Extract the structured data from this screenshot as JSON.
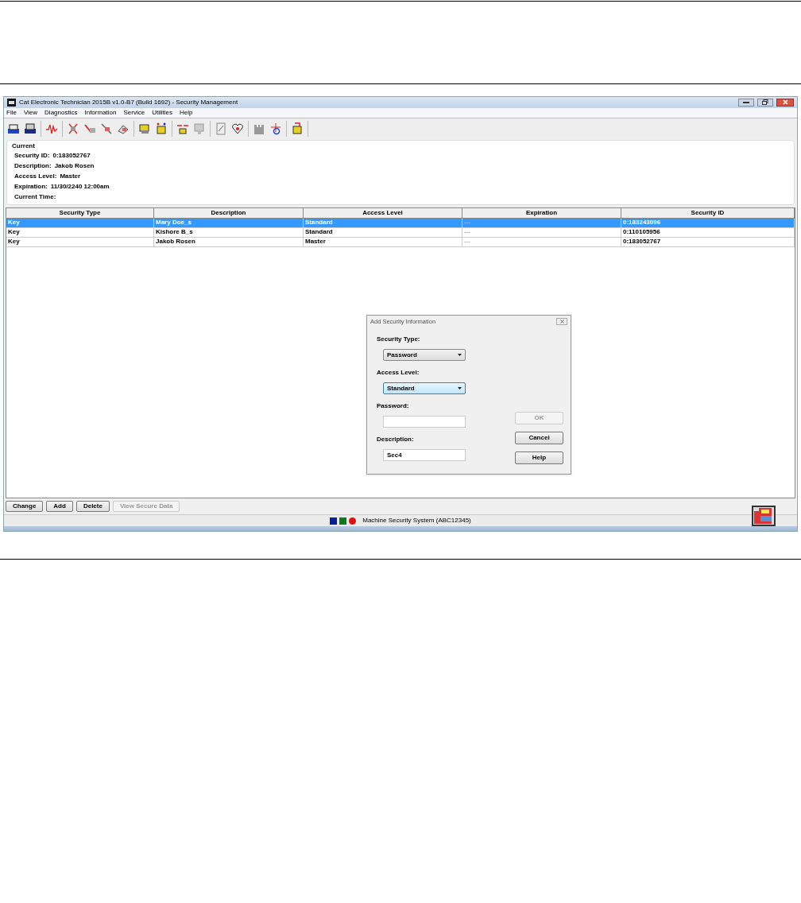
{
  "window": {
    "title": "Cat Electronic Technician 2015B v1.0-B7 (Build 1692) - Security Management"
  },
  "menu": [
    "File",
    "View",
    "Diagnostics",
    "Information",
    "Service",
    "Utilities",
    "Help"
  ],
  "current": {
    "title": "Current",
    "fields": [
      {
        "label": "Security ID:",
        "value": "0:183052767"
      },
      {
        "label": "Description:",
        "value": "Jakob Rosen"
      },
      {
        "label": "Access Level:",
        "value": "Master"
      },
      {
        "label": "Expiration:",
        "value": "11/30/2240 12:00am"
      },
      {
        "label": "Current Time:"
      }
    ]
  },
  "table": {
    "columns": [
      "Security Type",
      "Description",
      "Access Level",
      "Expiration",
      "Security ID"
    ],
    "rows": [
      {
        "selected": true,
        "cells": [
          "Key",
          "Mary Doe_s",
          "Standard",
          "---",
          "0:183243096"
        ]
      },
      {
        "selected": false,
        "cells": [
          "Key",
          "Kishore B_s",
          "Standard",
          "---",
          "0:110105956"
        ]
      },
      {
        "selected": false,
        "cells": [
          "Key",
          "Jakob Rosen",
          "Master",
          "---",
          "0:183052767"
        ]
      }
    ]
  },
  "buttons": [
    {
      "label": "Change",
      "disabled": false
    },
    {
      "label": "Add",
      "disabled": false
    },
    {
      "label": "Delete",
      "disabled": false
    },
    {
      "label": "View Secure Data",
      "disabled": true
    }
  ],
  "status_bar": {
    "indicators": [
      {
        "kind": "square",
        "color": "#0a1ea0"
      },
      {
        "kind": "square",
        "color": "#0a7a1e"
      },
      {
        "kind": "circle",
        "color": "#e01010"
      }
    ],
    "text": "Machine Security System (ABC12345)"
  },
  "dialog": {
    "title": "Add Security Information",
    "fields": [
      {
        "kind": "dropdown",
        "label": "Security Type:",
        "value": "Password",
        "focused": false
      },
      {
        "kind": "dropdown",
        "label": "Access Level:",
        "value": "Standard",
        "focused": true
      },
      {
        "kind": "input",
        "label": "Password:"
      },
      {
        "kind": "input",
        "label": "Description:",
        "value": "Sec4"
      }
    ],
    "buttons": [
      {
        "label": "OK",
        "disabled": true
      },
      {
        "label": "Cancel",
        "disabled": false
      },
      {
        "label": "Help",
        "disabled": false
      }
    ]
  }
}
